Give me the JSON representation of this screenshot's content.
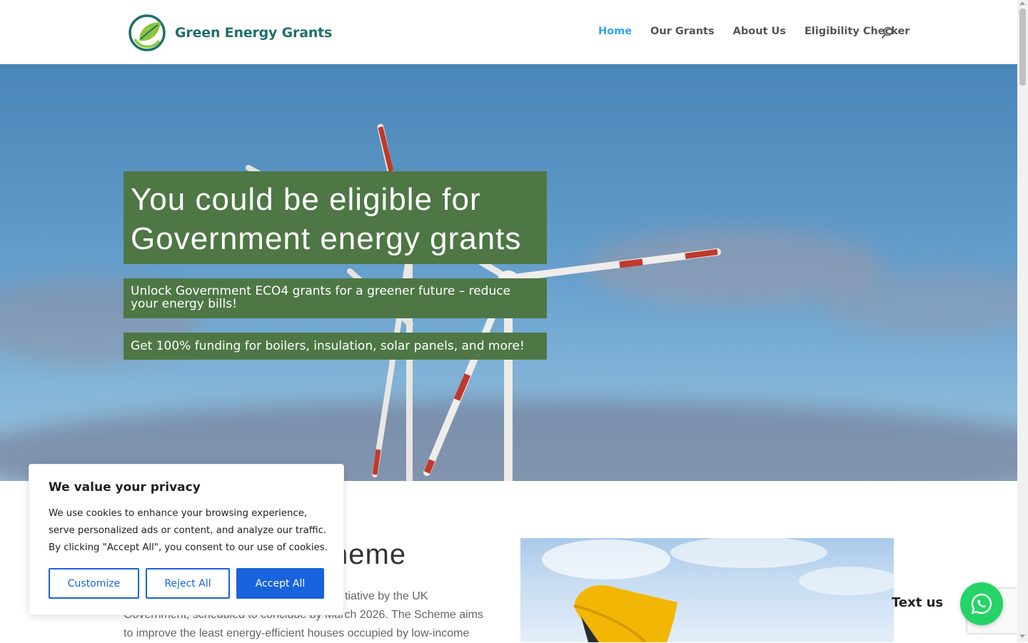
{
  "brand": {
    "name": "Green Energy Grants",
    "color": "#1f6f6a",
    "logo_icon": "leaf-circle-icon"
  },
  "nav": {
    "items": [
      {
        "label": "Home",
        "active": true
      },
      {
        "label": "Our Grants",
        "active": false
      },
      {
        "label": "About Us",
        "active": false
      },
      {
        "label": "Eligibility Checker",
        "active": false
      }
    ],
    "search_icon": "search-icon",
    "active_color": "#2ea3f2"
  },
  "hero": {
    "headline": "You could be eligible for Government energy grants",
    "subheading": "Unlock Government ECO4 grants for a greener future – reduce your energy bills!",
    "tagline": "Get 100% funding for boilers, insulation, solar panels, and more!",
    "box_color": "#4e7745"
  },
  "content": {
    "title_visible": "heme",
    "body_visible": "tiative by the UK Government, scheduled to conclude by March 2026. The Scheme aims to improve the least energy-efficient houses occupied by low-income"
  },
  "cookie_banner": {
    "title": "We value your privacy",
    "text": "We use cookies to enhance your browsing experience, serve personalized ads or content, and analyze our traffic. By clicking \"Accept All\", you consent to our use of cookies.",
    "customize_label": "Customize",
    "reject_label": "Reject All",
    "accept_label": "Accept All",
    "accent_color": "#1863dc"
  },
  "chat": {
    "label": "Text us",
    "icon": "whatsapp-icon",
    "color": "#25d366"
  }
}
